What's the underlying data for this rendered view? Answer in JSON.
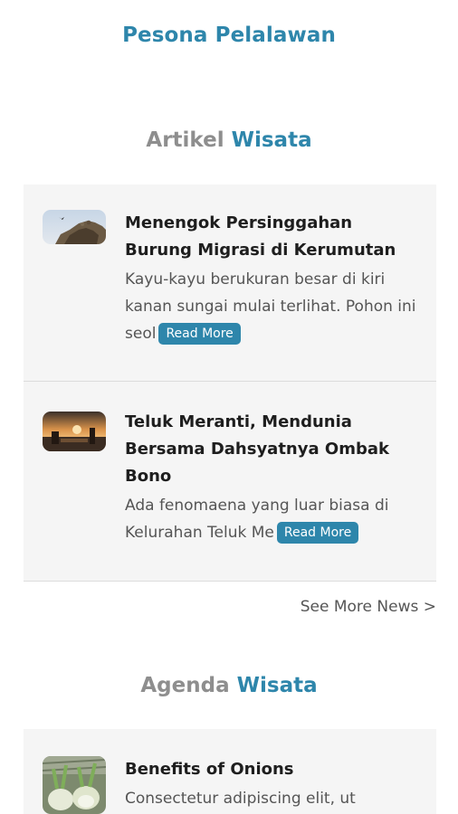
{
  "header": {
    "title": "Pesona Pelalawan"
  },
  "articles_section": {
    "heading_muted": "Artikel",
    "heading_accent": "Wisata",
    "items": [
      {
        "title": "Menengok Persinggahan Burung Migrasi di Kerumutan",
        "excerpt": "Kayu-kayu berukuran besar di kiri kanan sungai mulai terlihat. Pohon ini seol",
        "read_more": "Read More"
      },
      {
        "title": "Teluk Meranti, Mendunia Bersama Dahsyatnya Ombak Bono",
        "excerpt": "Ada fenomaena yang luar biasa di Kelurahan Teluk Me",
        "read_more": "Read More"
      }
    ],
    "see_more": "See More News >"
  },
  "agenda_section": {
    "heading_muted": "Agenda",
    "heading_accent": "Wisata",
    "items": [
      {
        "title": "Benefits of Onions",
        "excerpt": "Consectetur adipiscing elit, ut"
      }
    ]
  },
  "colors": {
    "accent": "#2e86ab",
    "muted_heading": "#8e8e8e",
    "card_background": "#f5f5f5"
  }
}
